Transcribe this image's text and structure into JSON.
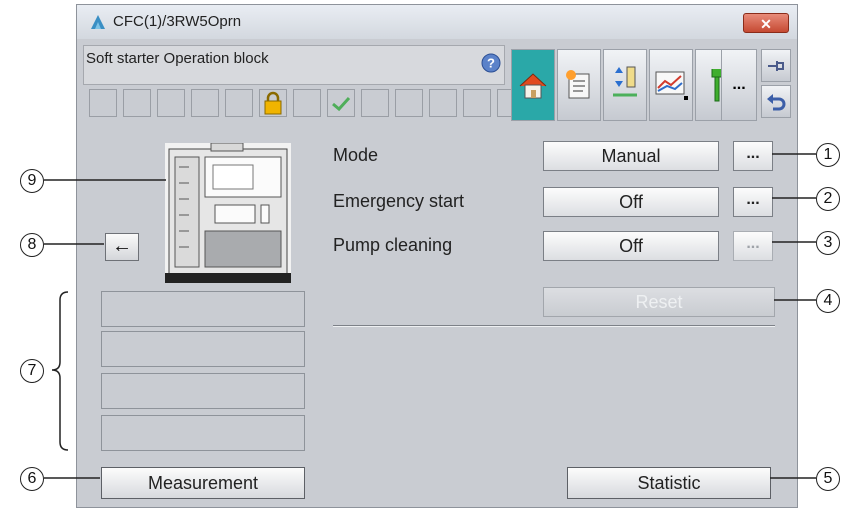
{
  "window": {
    "title": "CFC(1)/3RW5Oprn",
    "close_glyph": "✕"
  },
  "header": {
    "title": "Soft starter Operation block"
  },
  "toolbar": {
    "more_label": "..."
  },
  "controls": [
    {
      "label": "Mode",
      "value": "Manual",
      "button": "...",
      "enabled": true
    },
    {
      "label": "Emergency start",
      "value": "Off",
      "button": "...",
      "enabled": true
    },
    {
      "label": "Pump cleaning",
      "value": "Off",
      "button": "...",
      "enabled": false
    }
  ],
  "reset_label": "Reset",
  "back_glyph": "←",
  "bottom": {
    "measurement": "Measurement",
    "statistic": "Statistic"
  },
  "callouts": [
    "1",
    "2",
    "3",
    "4",
    "5",
    "6",
    "7",
    "8",
    "9"
  ],
  "icons": [
    "app-icon",
    "close-icon",
    "help-icon",
    "lock-icon",
    "check-icon",
    "home-icon",
    "message-list-icon",
    "parameter-icon",
    "trend-icon",
    "wrench-icon",
    "pin-icon",
    "undo-icon",
    "device-image",
    "arrow-left-icon"
  ],
  "colors": {
    "panel": "#c9ccd2",
    "active_tool": "#2aa8a8",
    "close": "#c54a33",
    "lock": "#f0b400"
  }
}
